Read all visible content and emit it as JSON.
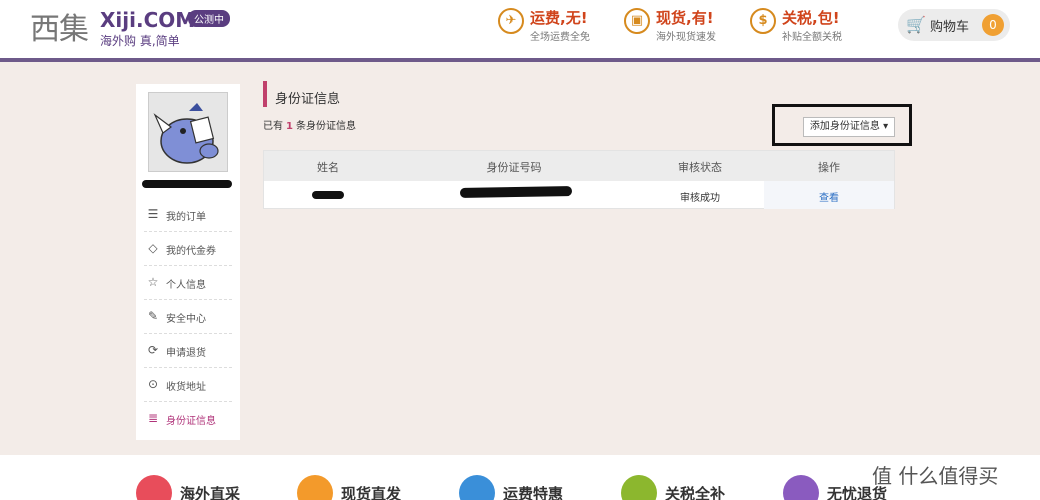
{
  "header": {
    "logo_cn": "西集",
    "logo_en": "Xiji.COM",
    "logo_badge": "公测中",
    "logo_tagline": "海外购 真,简单",
    "promos": [
      {
        "title": "运费,无!",
        "sub": "全场运费全免",
        "icon": "plane-icon"
      },
      {
        "title": "现货,有!",
        "sub": "海外现货速发",
        "icon": "gift-box-icon"
      },
      {
        "title": "关税,包!",
        "sub": "补贴全额关税",
        "icon": "dollar-tag-icon"
      }
    ],
    "cart_label": "购物车",
    "cart_count": "0"
  },
  "sidebar": {
    "items": [
      {
        "label": "我的订单",
        "icon": "order-list-icon"
      },
      {
        "label": "我的代金券",
        "icon": "coupon-tag-icon"
      },
      {
        "label": "个人信息",
        "icon": "star-icon"
      },
      {
        "label": "安全中心",
        "icon": "edit-icon"
      },
      {
        "label": "申请退货",
        "icon": "refresh-icon"
      },
      {
        "label": "收货地址",
        "icon": "location-pin-icon"
      },
      {
        "label": "身份证信息",
        "icon": "id-card-icon"
      }
    ]
  },
  "main": {
    "title": "身份证信息",
    "count_prefix": "已有",
    "count_value": "1",
    "count_suffix": "条身份证信息",
    "add_button": "添加身份证信息",
    "table": {
      "headers": [
        "姓名",
        "身份证号码",
        "审核状态",
        "操作"
      ],
      "rows": [
        {
          "status": "审核成功",
          "action": "查看"
        }
      ]
    }
  },
  "footer": {
    "items": [
      {
        "label": "海外直采",
        "color": "#e84d5b"
      },
      {
        "label": "现货直发",
        "color": "#f39a2b"
      },
      {
        "label": "运费特惠",
        "color": "#3a8fd9"
      },
      {
        "label": "关税全补",
        "color": "#8cb72e"
      },
      {
        "label": "无忧退货",
        "color": "#8a5bbf"
      }
    ],
    "watermark": "值 什么值得买"
  },
  "colors": {
    "brand_purple": "#5a3d80",
    "accent_pink": "#c0416c",
    "promo_orange": "#d68a1e",
    "link_blue": "#2b6fc4"
  }
}
